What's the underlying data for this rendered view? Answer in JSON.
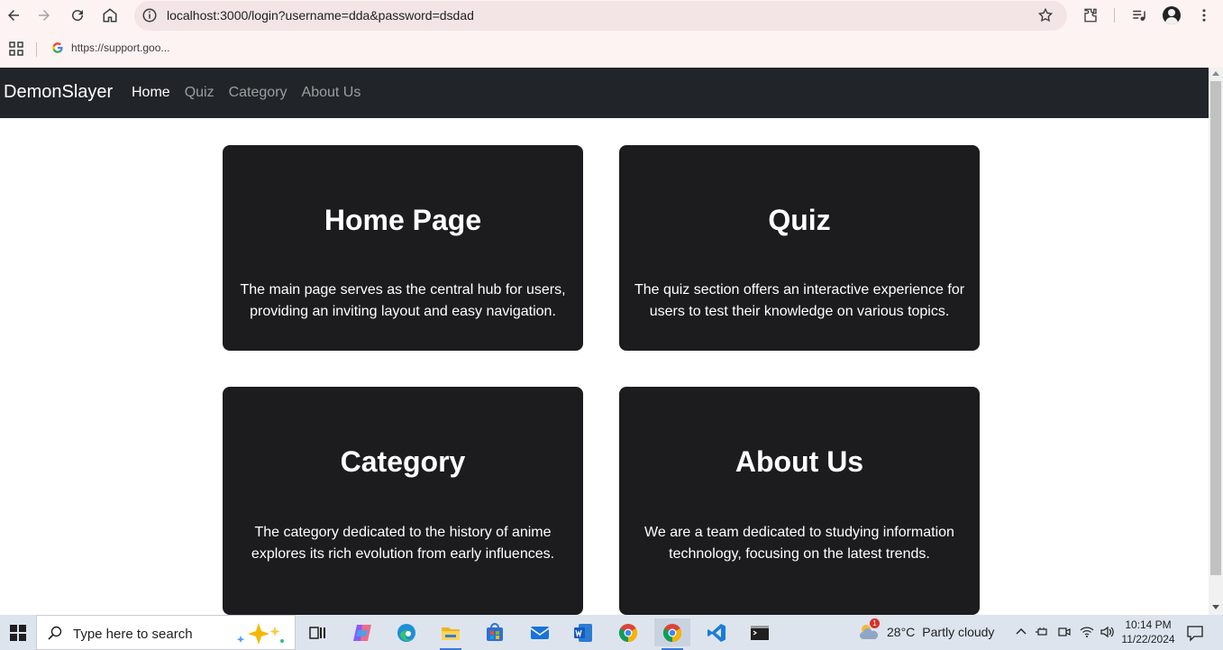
{
  "browser": {
    "url": "localhost:3000/login?username=dda&password=dsdad",
    "bookmark_label": "https://support.goo..."
  },
  "navbar": {
    "brand": "DemonSlayer",
    "links": [
      {
        "label": "Home",
        "active": true
      },
      {
        "label": "Quiz",
        "active": false
      },
      {
        "label": "Category",
        "active": false
      },
      {
        "label": "About Us",
        "active": false
      }
    ]
  },
  "cards": [
    {
      "title": "Home Page",
      "text": "The main page serves as the central hub for users, providing an inviting layout and easy navigation."
    },
    {
      "title": "Quiz",
      "text": "The quiz section offers an interactive experience for users to test their knowledge on various topics."
    },
    {
      "title": "Category",
      "text": "The category dedicated to the history of anime explores its rich evolution from early influences."
    },
    {
      "title": "About Us",
      "text": "We are a team dedicated to studying information technology, focusing on the latest trends."
    }
  ],
  "taskbar": {
    "search_placeholder": "Type here to search",
    "weather_temp": "28°C",
    "weather_desc": "Partly cloudy",
    "weather_badge": "1",
    "time": "10:14 PM",
    "date": "11/22/2024"
  },
  "colors": {
    "navbar_bg": "#212529",
    "card_bg": "#1c1c1e",
    "chrome_bg": "#fdf3f3"
  }
}
